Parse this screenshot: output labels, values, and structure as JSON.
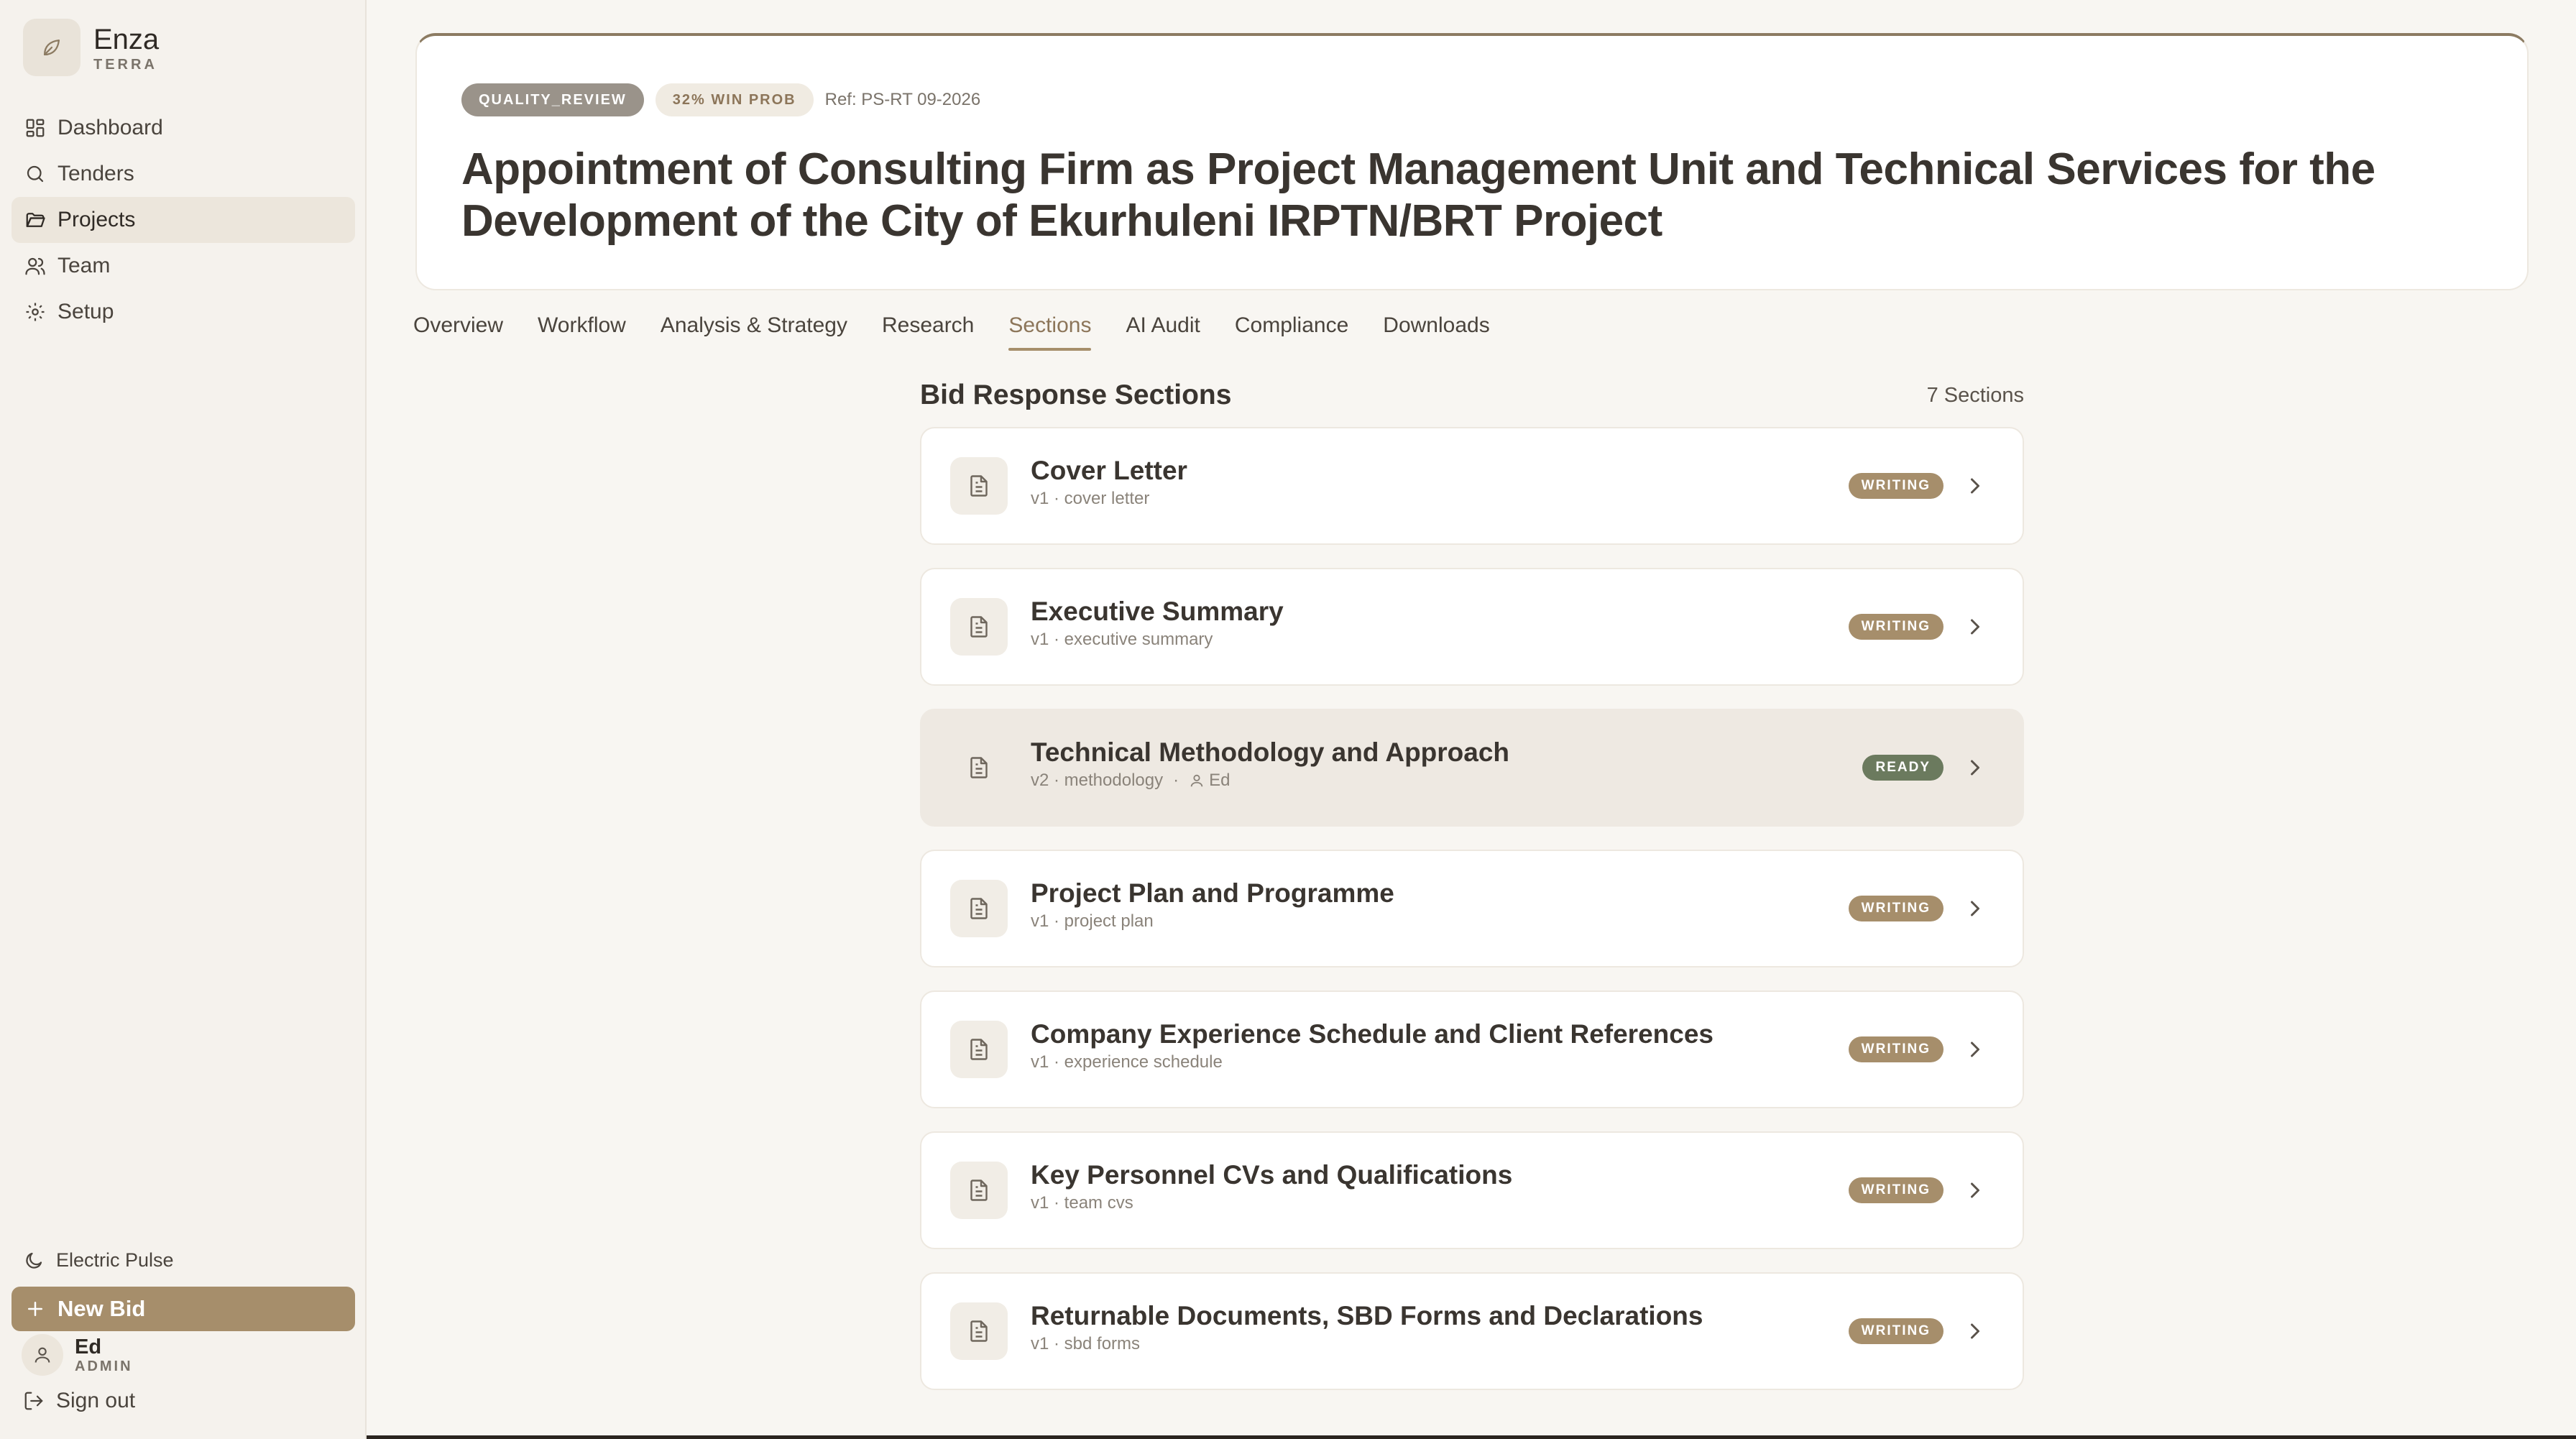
{
  "brand": {
    "name": "Enza",
    "sub": "TERRA",
    "logo_icon": "leaf-icon"
  },
  "nav": [
    {
      "label": "Dashboard",
      "icon": "dashboard-icon",
      "active": false
    },
    {
      "label": "Tenders",
      "icon": "search-icon",
      "active": false
    },
    {
      "label": "Projects",
      "icon": "folder-icon",
      "active": true
    },
    {
      "label": "Team",
      "icon": "users-icon",
      "active": false
    },
    {
      "label": "Setup",
      "icon": "gear-icon",
      "active": false
    }
  ],
  "theme": {
    "label": "Electric Pulse",
    "icon": "moon-icon"
  },
  "new_bid": {
    "label": "New Bid"
  },
  "user": {
    "name": "Ed",
    "role": "ADMIN"
  },
  "signout": {
    "label": "Sign out"
  },
  "project": {
    "status": "QUALITY_REVIEW",
    "win_prob": "32% WIN PROB",
    "ref": "Ref: PS-RT 09-2026",
    "title": "Appointment of Consulting Firm as Project Management Unit and Technical Services for the Development of the City of Ekurhuleni IRPTN/BRT Project"
  },
  "tabs": [
    {
      "label": "Overview",
      "active": false
    },
    {
      "label": "Workflow",
      "active": false
    },
    {
      "label": "Analysis & Strategy",
      "active": false
    },
    {
      "label": "Research",
      "active": false
    },
    {
      "label": "Sections",
      "active": true
    },
    {
      "label": "AI Audit",
      "active": false
    },
    {
      "label": "Compliance",
      "active": false
    },
    {
      "label": "Downloads",
      "active": false
    }
  ],
  "sections_header": {
    "title": "Bid Response Sections",
    "count": "7 Sections"
  },
  "sections": [
    {
      "name": "Cover Letter",
      "meta": "v1 · cover letter",
      "status": "WRITING"
    },
    {
      "name": "Executive Summary",
      "meta": "v1 · executive summary",
      "status": "WRITING"
    },
    {
      "name": "Technical Methodology and Approach",
      "meta": "v2 · methodology",
      "assignee": "Ed",
      "status": "READY"
    },
    {
      "name": "Project Plan and Programme",
      "meta": "v1 · project plan",
      "status": "WRITING"
    },
    {
      "name": "Company Experience Schedule and Client References",
      "meta": "v1 · experience schedule",
      "status": "WRITING"
    },
    {
      "name": "Key Personnel CVs and Qualifications",
      "meta": "v1 · team cvs",
      "status": "WRITING"
    },
    {
      "name": "Returnable Documents, SBD Forms and Declarations",
      "meta": "v1 · sbd forms",
      "status": "WRITING"
    }
  ],
  "colors": {
    "accent": "#A68E6B",
    "ready": "#6B7A5E",
    "background": "#F8F6F2"
  }
}
